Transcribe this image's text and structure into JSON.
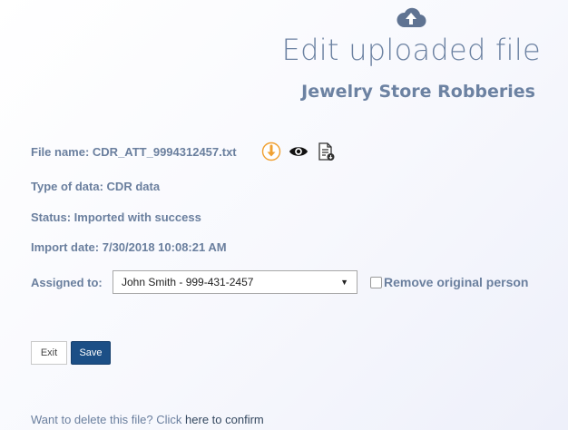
{
  "header": {
    "title": "Edit uploaded file",
    "subtitle": "Jewelry Store Robberies",
    "icon": "cloud-upload-icon"
  },
  "details": {
    "file_name": "File name: CDR_ATT_9994312457.txt",
    "type_of_data": "Type of data: CDR data",
    "status": "Status: Imported with success",
    "import_date": "Import date: 7/30/2018 10:08:21 AM",
    "assigned_label": "Assigned to:"
  },
  "file_icons": [
    "download-icon",
    "view-icon",
    "file-info-icon"
  ],
  "assigned": {
    "selected": "John Smith - 999-431-2457",
    "caret": "▼"
  },
  "remove_original": {
    "label": "Remove original person",
    "checked": false
  },
  "buttons": {
    "exit": "Exit",
    "save": "Save"
  },
  "delete": {
    "prefix": "Want to delete this file? Click ",
    "link": "here to confirm"
  },
  "colors": {
    "text": "#6a7f9e",
    "title": "#6c82a2",
    "primary": "#1c4f86",
    "download": "#f0a030"
  }
}
